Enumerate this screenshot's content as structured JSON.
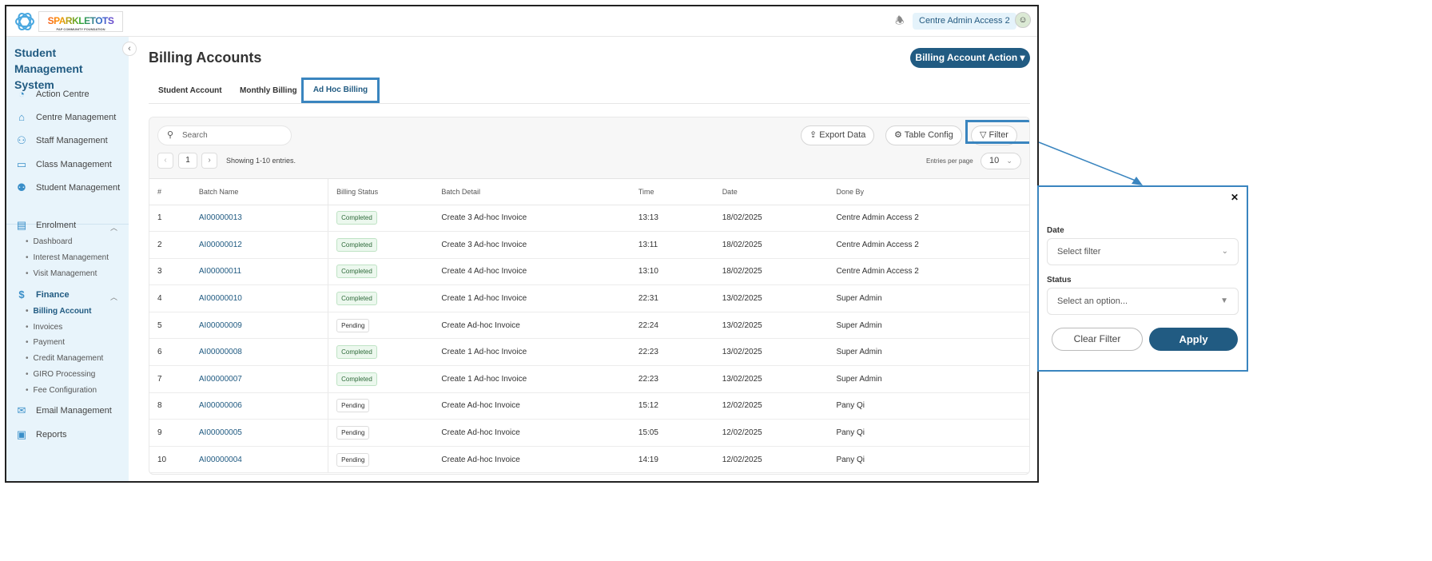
{
  "header": {
    "brand": "SPARKLETOTS",
    "brand_sub": "PAP COMMUNITY FOUNDATION",
    "user": "Centre Admin Access 2"
  },
  "sidebar": {
    "title": "Student Management System",
    "items": [
      {
        "label": "Action Centre"
      },
      {
        "label": "Centre Management"
      },
      {
        "label": "Staff Management"
      },
      {
        "label": "Class Management"
      },
      {
        "label": "Student Management"
      }
    ],
    "enrolment": {
      "label": "Enrolment",
      "subs": [
        "Dashboard",
        "Interest Management",
        "Visit Management"
      ]
    },
    "finance": {
      "label": "Finance",
      "subs": [
        "Billing Account",
        "Invoices",
        "Payment",
        "Credit Management",
        "GIRO Processing",
        "Fee Configuration"
      ]
    },
    "bottom": [
      {
        "label": "Email Management"
      },
      {
        "label": "Reports"
      }
    ]
  },
  "page": {
    "title": "Billing Accounts",
    "action": "Billing Account Action",
    "tabs": [
      "Student Account",
      "Monthly Billing",
      "Ad Hoc Billing"
    ]
  },
  "toolbar": {
    "search_placeholder": "Search",
    "page": "1",
    "showing": "Showing 1-10 entries.",
    "export": "Export Data",
    "config": "Table Config",
    "filter": "Filter",
    "epp_label": "Entries per page",
    "epp_value": "10"
  },
  "table": {
    "headers": [
      "#",
      "Batch Name",
      "Billing Status",
      "Batch Detail",
      "Time",
      "Date",
      "Done By"
    ],
    "rows": [
      [
        "1",
        "AI00000013",
        "Completed",
        "Create 3 Ad-hoc Invoice",
        "13:13",
        "18/02/2025",
        "Centre Admin Access 2"
      ],
      [
        "2",
        "AI00000012",
        "Completed",
        "Create 3 Ad-hoc Invoice",
        "13:11",
        "18/02/2025",
        "Centre Admin Access 2"
      ],
      [
        "3",
        "AI00000011",
        "Completed",
        "Create 4 Ad-hoc Invoice",
        "13:10",
        "18/02/2025",
        "Centre Admin Access 2"
      ],
      [
        "4",
        "AI00000010",
        "Completed",
        "Create 1 Ad-hoc Invoice",
        "22:31",
        "13/02/2025",
        "Super Admin"
      ],
      [
        "5",
        "AI00000009",
        "Pending",
        "Create Ad-hoc Invoice",
        "22:24",
        "13/02/2025",
        "Super Admin"
      ],
      [
        "6",
        "AI00000008",
        "Completed",
        "Create 1 Ad-hoc Invoice",
        "22:23",
        "13/02/2025",
        "Super Admin"
      ],
      [
        "7",
        "AI00000007",
        "Completed",
        "Create 1 Ad-hoc Invoice",
        "22:23",
        "13/02/2025",
        "Super Admin"
      ],
      [
        "8",
        "AI00000006",
        "Pending",
        "Create Ad-hoc Invoice",
        "15:12",
        "12/02/2025",
        "Pany Qi"
      ],
      [
        "9",
        "AI00000005",
        "Pending",
        "Create Ad-hoc Invoice",
        "15:05",
        "12/02/2025",
        "Pany Qi"
      ],
      [
        "10",
        "AI00000004",
        "Pending",
        "Create Ad-hoc Invoice",
        "14:19",
        "12/02/2025",
        "Pany Qi"
      ]
    ]
  },
  "filter_panel": {
    "date_label": "Date",
    "date_placeholder": "Select filter",
    "status_label": "Status",
    "status_placeholder": "Select an option...",
    "clear": "Clear Filter",
    "apply": "Apply"
  }
}
